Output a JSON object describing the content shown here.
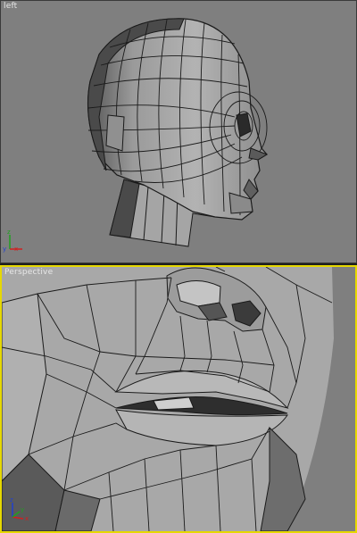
{
  "viewports": {
    "left": {
      "label": "left"
    },
    "perspective": {
      "label": "Perspective"
    }
  },
  "gizmo": {
    "x": "x",
    "y": "y",
    "z": "z"
  },
  "colors": {
    "background": "#7f7f7f",
    "active_border": "#e6d800",
    "mesh_light": "#a9a9a9",
    "mesh_dark": "#3b3b3b",
    "wire": "#1a1a1a",
    "axis_x": "#d02020",
    "axis_y": "#20a020",
    "axis_z": "#2040d0"
  }
}
